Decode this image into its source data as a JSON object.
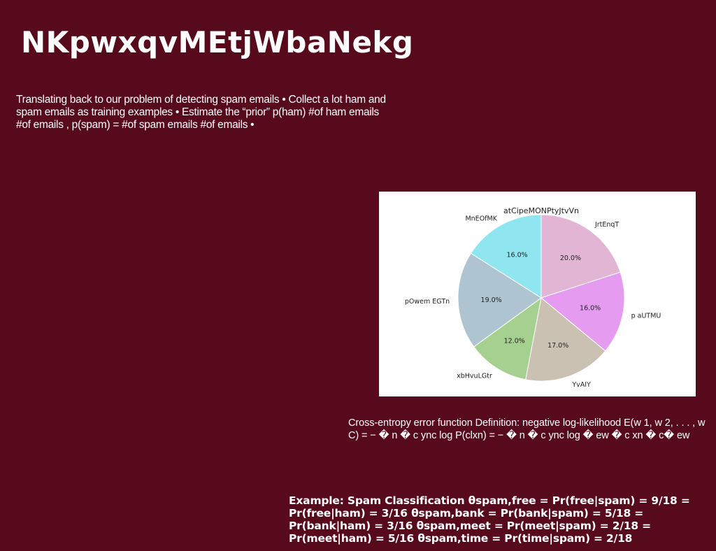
{
  "slide": {
    "title": "NKpwxqvMEtjWbaNekg",
    "paragraph_1": "Translating back to our problem of detecting spam emails • Collect a lot ham and spam emails as training examples • Estimate the “prior” p(ham) #of ham emails #of emails , p(spam) = #of spam emails #of emails •",
    "paragraph_2": "Cross-entropy error function Definition: negative log-likelihood E(w 1, w 2, . . . , w C) = − � n � c ync log P(clxn) = − � n � c ync log � ew � c xn � c� ew",
    "paragraph_3": "Example: Spam Classification θspam,free = Pr(free|spam) = 9/18 = Pr(free|ham) = 3/16 θspam,bank = Pr(bank|spam) = 5/18 = Pr(bank|ham) = 3/16 θspam,meet = Pr(meet|spam) = 2/18 = Pr(meet|ham) = 5/16 θspam,time = Pr(time|spam) = 2/18"
  },
  "chart_data": {
    "type": "pie",
    "title": "atCipeMONPtyJtvVn",
    "start_angle": "top, clockwise",
    "slices": [
      {
        "label": "JrtEnqT",
        "value": 20.0,
        "display": "20.0%",
        "color": "#e3b5d5"
      },
      {
        "label": "p aUTMU",
        "value": 16.0,
        "display": "16.0%",
        "color": "#e59cf0"
      },
      {
        "label": "YvAIY",
        "value": 17.0,
        "display": "17.0%",
        "color": "#cbc1b3"
      },
      {
        "label": "xbHvuLGtr",
        "value": 12.0,
        "display": "12.0%",
        "color": "#a5d08f"
      },
      {
        "label": "pOwem EGTn",
        "value": 19.0,
        "display": "19.0%",
        "color": "#aec4d1"
      },
      {
        "label": "MnEOfMK",
        "value": 16.0,
        "display": "16.0%",
        "color": "#8fe5f0"
      }
    ]
  }
}
